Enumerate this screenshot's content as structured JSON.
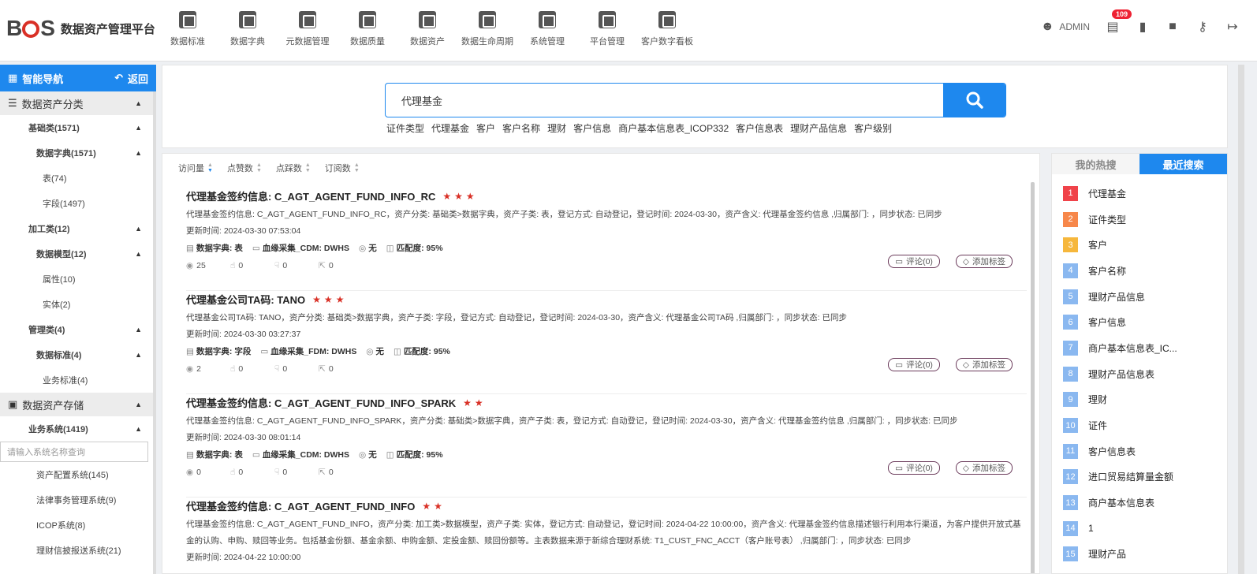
{
  "header": {
    "logo_b": "B",
    "logo_s": "S",
    "app_title": "数据资产管理平台",
    "nav": [
      "数据标准",
      "数据字典",
      "元数据管理",
      "数据质量",
      "数据资产",
      "数据生命周期",
      "系统管理",
      "平台管理",
      "客户数字看板"
    ],
    "user": "ADMIN",
    "badge": "109"
  },
  "sidebar": {
    "title": "智能导航",
    "back": "返回",
    "sec1": "数据资产分类",
    "sec2": "数据资产存储",
    "tree": [
      {
        "label": "基础类(1571)",
        "level": "l1",
        "caret": true
      },
      {
        "label": "数据字典(1571)",
        "level": "l2",
        "caret": true
      },
      {
        "label": "表(74)",
        "level": "l3",
        "caret": false
      },
      {
        "label": "字段(1497)",
        "level": "l3",
        "caret": false
      },
      {
        "label": "加工类(12)",
        "level": "l1",
        "caret": true
      },
      {
        "label": "数据模型(12)",
        "level": "l2",
        "caret": true
      },
      {
        "label": "属性(10)",
        "level": "l3",
        "caret": false
      },
      {
        "label": "实体(2)",
        "level": "l3",
        "caret": false
      },
      {
        "label": "管理类(4)",
        "level": "l1",
        "caret": true
      },
      {
        "label": "数据标准(4)",
        "level": "l2",
        "caret": true
      },
      {
        "label": "业务标准(4)",
        "level": "l3",
        "caret": false
      }
    ],
    "biz": "业务系统(1419)",
    "search_placeholder": "请输入系统名称查询",
    "systems": [
      "资产配置系统(145)",
      "法律事务管理系统(9)",
      "ICOP系统(8)",
      "理财信披报送系统(21)"
    ]
  },
  "search": {
    "value": "代理基金",
    "hotwords": [
      "证件类型",
      "代理基金",
      "客户",
      "客户名称",
      "理财",
      "客户信息",
      "商户基本信息表_ICOP332",
      "客户信息表",
      "理财产品信息",
      "客户级别"
    ]
  },
  "sort": [
    "访问量",
    "点赞数",
    "点踩数",
    "订阅数"
  ],
  "results": [
    {
      "title": "代理基金签约信息: C_AGT_AGENT_FUND_INFO_RC",
      "stars": "★★★",
      "desc": "代理基金签约信息: C_AGT_AGENT_FUND_INFO_RC，资产分类: 基础类>数据字典，资产子类: 表，登记方式: 自动登记，登记时间: 2024-03-30，资产含义: 代理基金签约信息 ,归属部门: ，同步状态: 已同步",
      "time": "更新时间: 2024-03-30 07:53:04",
      "m1": "数据字典: 表",
      "m2": "血缘采集_CDM: DWHS",
      "m3": "无",
      "m4": "匹配度: 95%",
      "views": "25",
      "likes": "0",
      "dislikes": "0",
      "subs": "0"
    },
    {
      "title": "代理基金公司TA码: TANO",
      "stars": "★★★",
      "desc": "代理基金公司TA码: TANO，资产分类: 基础类>数据字典，资产子类: 字段，登记方式: 自动登记，登记时间: 2024-03-30，资产含义: 代理基金公司TA码 ,归属部门: ，同步状态: 已同步",
      "time": "更新时间: 2024-03-30 03:27:37",
      "m1": "数据字典: 字段",
      "m2": "血缘采集_FDM: DWHS",
      "m3": "无",
      "m4": "匹配度: 95%",
      "views": "2",
      "likes": "0",
      "dislikes": "0",
      "subs": "0"
    },
    {
      "title": "代理基金签约信息: C_AGT_AGENT_FUND_INFO_SPARK",
      "stars": "★★",
      "desc": "代理基金签约信息: C_AGT_AGENT_FUND_INFO_SPARK，资产分类: 基础类>数据字典，资产子类: 表，登记方式: 自动登记，登记时间: 2024-03-30，资产含义: 代理基金签约信息 ,归属部门: ，同步状态: 已同步",
      "time": "更新时间: 2024-03-30 08:01:14",
      "m1": "数据字典: 表",
      "m2": "血缘采集_CDM: DWHS",
      "m3": "无",
      "m4": "匹配度: 95%",
      "views": "0",
      "likes": "0",
      "dislikes": "0",
      "subs": "0"
    },
    {
      "title": "代理基金签约信息: C_AGT_AGENT_FUND_INFO",
      "stars": "★★",
      "desc": "代理基金签约信息: C_AGT_AGENT_FUND_INFO，资产分类: 加工类>数据模型，资产子类: 实体，登记方式: 自动登记，登记时间: 2024-04-22 10:00:00，资产含义: 代理基金签约信息描述银行利用本行渠道，为客户提供开放式基金的认购、申购、赎回等业务。包括基金份额、基金余额、申购金额、定投金额、赎回份额等。主表数据来源于新综合理财系统: T1_CUST_FNC_ACCT（客户账号表） ,归属部门: ，同步状态: 已同步",
      "time": "更新时间: 2024-04-22 10:00:00",
      "m1": "",
      "m2": "",
      "m3": "",
      "m4": "",
      "views": "",
      "likes": "",
      "dislikes": "",
      "subs": ""
    }
  ],
  "buttons": {
    "comment": "评论(0)",
    "tag": "添加标签"
  },
  "rpanel": {
    "tab1": "我的热搜",
    "tab2": "最近搜索",
    "items": [
      {
        "n": "1",
        "label": "代理基金",
        "color": "#f0434a"
      },
      {
        "n": "2",
        "label": "证件类型",
        "color": "#f7874a"
      },
      {
        "n": "3",
        "label": "客户",
        "color": "#f6b73c"
      },
      {
        "n": "4",
        "label": "客户名称",
        "color": "#8ab8f0"
      },
      {
        "n": "5",
        "label": "理财产品信息",
        "color": "#8ab8f0"
      },
      {
        "n": "6",
        "label": "客户信息",
        "color": "#8ab8f0"
      },
      {
        "n": "7",
        "label": "商户基本信息表_IC...",
        "color": "#8ab8f0"
      },
      {
        "n": "8",
        "label": "理财产品信息表",
        "color": "#8ab8f0"
      },
      {
        "n": "9",
        "label": "理财",
        "color": "#8ab8f0"
      },
      {
        "n": "10",
        "label": "证件",
        "color": "#8ab8f0"
      },
      {
        "n": "11",
        "label": "客户信息表",
        "color": "#8ab8f0"
      },
      {
        "n": "12",
        "label": "进口贸易结算量金额",
        "color": "#8ab8f0"
      },
      {
        "n": "13",
        "label": "商户基本信息表",
        "color": "#8ab8f0"
      },
      {
        "n": "14",
        "label": "1",
        "color": "#8ab8f0"
      },
      {
        "n": "15",
        "label": "理财产品",
        "color": "#8ab8f0"
      }
    ]
  }
}
